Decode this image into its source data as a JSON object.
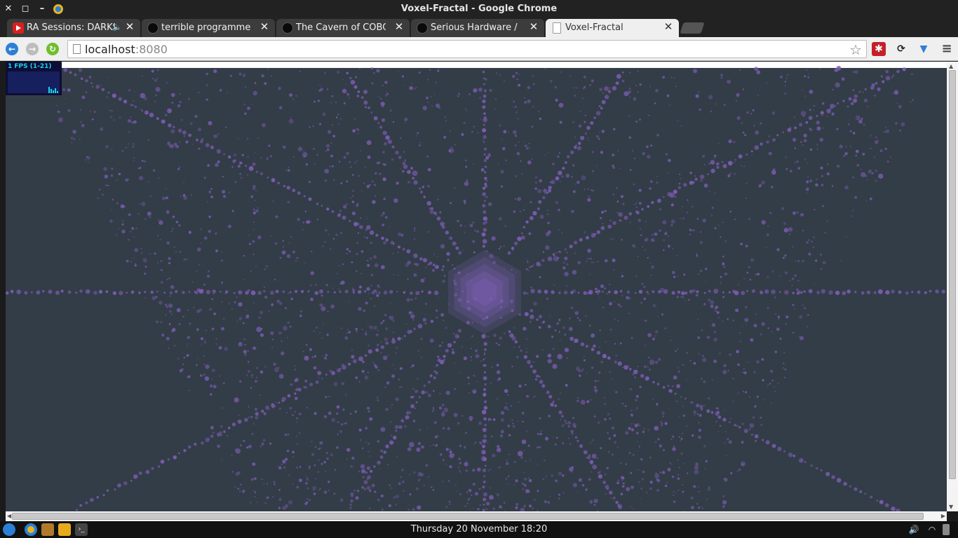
{
  "window": {
    "title": "Voxel-Fractal - Google Chrome",
    "controls": [
      "close",
      "maximize",
      "minimize"
    ]
  },
  "tabs": [
    {
      "label": "RA Sessions: DARKSI",
      "favicon": "youtube-icon",
      "audio": true,
      "active": false
    },
    {
      "label": "terrible programmer sa",
      "favicon": "bomb-icon",
      "audio": false,
      "active": false
    },
    {
      "label": "The Cavern of COBOL -",
      "favicon": "bomb-icon",
      "audio": false,
      "active": false
    },
    {
      "label": "Serious Hardware / Soft",
      "favicon": "bomb-icon",
      "audio": false,
      "active": false
    },
    {
      "label": "Voxel-Fractal",
      "favicon": "page-icon",
      "audio": false,
      "active": true
    }
  ],
  "toolbar": {
    "url_host": "localhost",
    "url_port": ":8080",
    "back_icon": "back-arrow-icon",
    "forward_icon": "forward-arrow-icon",
    "reload_icon": "reload-icon",
    "bookmark_icon": "star-icon",
    "menu_icon": "hamburger-menu-icon"
  },
  "page": {
    "fps_label": "1 FPS (1-21)",
    "colors": {
      "background": "#333d47",
      "voxel": "#7d5cb6",
      "core": "#8865c4"
    }
  },
  "taskbar": {
    "clock": "Thursday 20 November 18:20"
  }
}
